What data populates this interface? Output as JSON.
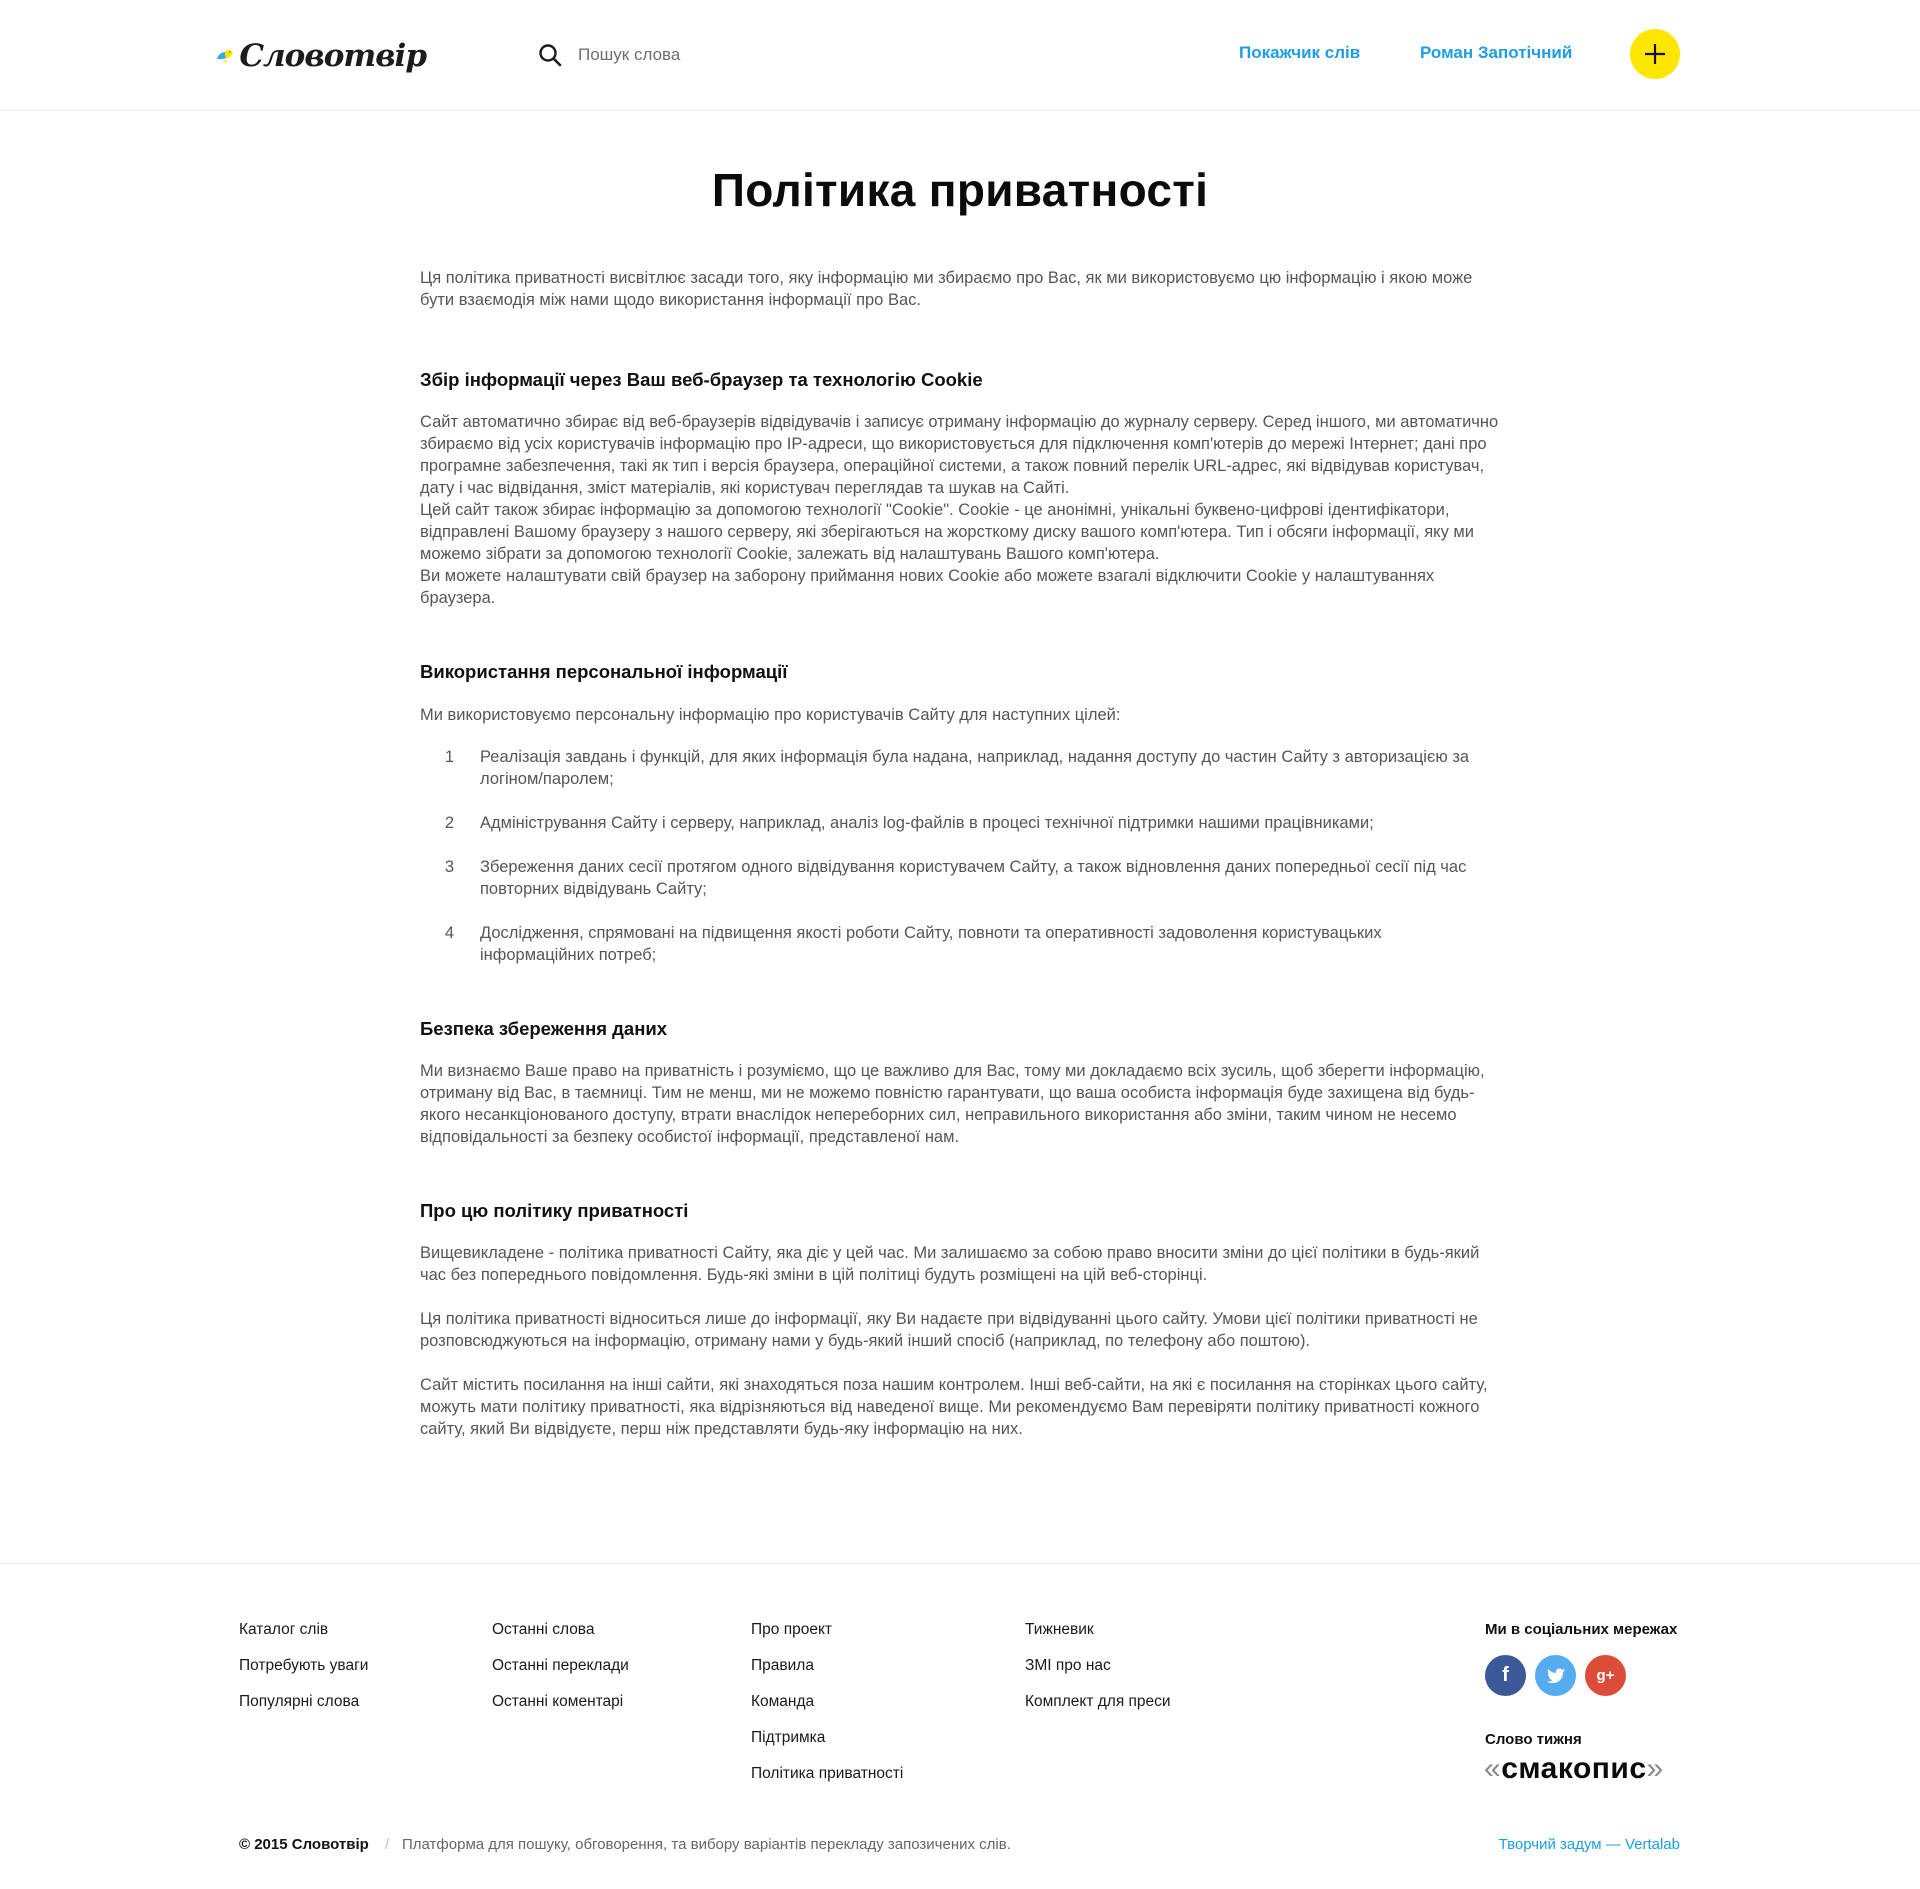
{
  "header": {
    "logo_text": "Словотвір",
    "search_placeholder": "Пошук слова",
    "nav_index": "Покажчик слів",
    "nav_user": "Роман Запотічний",
    "add_icon": "plus-icon",
    "accent_color": "#ffe600",
    "link_color": "#1d9ee2"
  },
  "main": {
    "title": "Політика приватності",
    "intro": "Ця політика приватності висвітлює засади того, яку інформацію ми збираємо про Вас, як ми використовуємо цю інформацію і якою може бути взаємодія між нами щодо використання інформації про Вас.",
    "section1": {
      "title": "Збір інформації через Ваш веб-браузер та технологію Cookie",
      "body": "Сайт автоматично збирає від веб-браузерів відвідувачів і записує отриману інформацію до журналу серверу. Серед іншого, ми автоматично збираємо від усіх користувачів інформацію про IP-адреси, що використовується для підключення комп'ютерів до мережі Інтернет; дані про програмне забезпечення, такі як тип і версія браузера, операційної системи, а також повний перелік URL-адрес, які відвідував користувач, дату і час відвідання, зміст матеріалів, які користувач переглядав та шукав на Сайті.\nЦей сайт також збирає інформацію за допомогою технології \"Cookie\". Cookie - це анонімні, унікальні буквено-цифрові ідентифікатори, відправлені Вашому браузеру з нашого серверу, які зберігаються на жорсткому диску вашого комп'ютера. Тип і обсяги інформації, яку ми можемо зібрати за допомогою технології Cookie, залежать від налаштувань Вашого комп'ютера.\nВи можете налаштувати свій браузер на заборону приймання нових Cookie або можете взагалі відключити Cookie у налаштуваннях браузера."
    },
    "section2": {
      "title": "Використання персональної інформації",
      "body": "Ми використовуємо персональну інформацію про користувачів Сайту для наступних цілей:",
      "items": [
        {
          "num": "1",
          "text": "Реалізація завдань і функцій, для яких інформація була надана, наприклад, надання доступу до частин Сайту з авторизацією за логіном/паролем;"
        },
        {
          "num": "2",
          "text": "Адміністрування Сайту і серверу, наприклад, аналіз log-файлів в процесі технічної підтримки нашими працівниками;"
        },
        {
          "num": "3",
          "text": "Збереження даних сесії протягом одного відвідування користувачем Сайту, а також відновлення даних попередньої сесії під час повторних відвідувань Сайту;"
        },
        {
          "num": "4",
          "text": "Дослідження, спрямовані на підвищення якості роботи Сайту, повноти та оперативності задоволення користувацьких інформаційних потреб;"
        }
      ]
    },
    "section3": {
      "title": "Безпека збереження даних",
      "body": "Ми визнаємо Ваше право на приватність і розуміємо, що це важливо для Вас, тому ми докладаємо всіх зусиль, щоб зберегти інформацію, отриману від Вас, в таємниці. Тим не менш, ми не можемо повністю гарантувати, що ваша особиста інформація буде захищена від будь-якого несанкціонованого доступу, втрати внаслідок непереборних сил, неправильного використання або зміни, таким чином не несемо відповідальності за безпеку особистої інформації, представленої нам."
    },
    "section4": {
      "title": "Про цю політику приватності",
      "body1": "Вищевикладене - політика приватності Сайту, яка діє у цей час. Ми залишаємо за собою право вносити зміни до цієї політики в будь-який час без попереднього повідомлення. Будь-які зміни в цій політиці будуть розміщені на цій веб-сторінці.",
      "body2": "Ця політика приватності відноситься лише до інформації, яку Ви надаєте при відвідуванні цього сайту. Умови цієї політики приватності не розповсюджуються на інформацію, отриману нами у будь-який інший спосіб (наприклад, по телефону або поштою).",
      "body3": "Сайт містить посилання на інші сайти, які знаходяться поза нашим контролем. Інші веб-сайти, на які є посилання на сторінках цього сайту, можуть мати політику приватності, яка відрізняються від наведеної вище. Ми рекомендуємо Вам перевіряти політику приватності кожного сайту, який Ви відвідуєте, перш ніж представляти будь-яку інформацію на них."
    }
  },
  "footer": {
    "col1": [
      "Каталог слів",
      "Потребують уваги",
      "Популярні слова"
    ],
    "col2": [
      "Останні слова",
      "Останні переклади",
      "Останні коментарі"
    ],
    "col3": [
      "Про проект",
      "Правила",
      "Команда",
      "Підтримка",
      "Політика приватності"
    ],
    "col4": [
      "Тижневик",
      "ЗМІ про нас",
      "Комплект для преси"
    ],
    "social_title": "Ми в соціальних мережах",
    "social_icons": [
      "facebook-icon",
      "twitter-icon",
      "google-plus-icon"
    ],
    "social_colors": {
      "facebook": "#3b5998",
      "twitter": "#55acee",
      "google_plus": "#dd4b39"
    },
    "word_of_week_label": "Слово тижня",
    "word_of_week": "смакопис",
    "copyright": "© 2015 Словотвір",
    "separator": "/",
    "tagline": "Платформа для пошуку, обговорення, та вибору варіантів перекладу запозичених слів.",
    "credit": "Творчий задум — Vertalab"
  }
}
